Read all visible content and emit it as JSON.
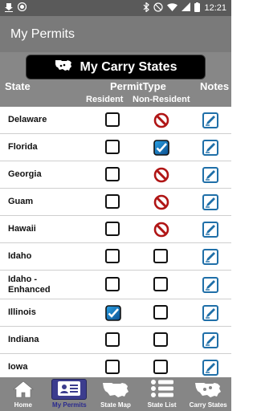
{
  "status_bar": {
    "time": "12:21"
  },
  "app_bar": {
    "title": "My Permits"
  },
  "carry_button": {
    "label": "My Carry States"
  },
  "columns": {
    "state": "State",
    "permit_type": "PermitType",
    "notes": "Notes",
    "resident": "Resident",
    "non_resident": "Non-Resident"
  },
  "rows": [
    {
      "name": "Delaware",
      "resident": "empty",
      "non_resident": "prohibited"
    },
    {
      "name": "Florida",
      "resident": "empty",
      "non_resident": "checked"
    },
    {
      "name": "Georgia",
      "resident": "empty",
      "non_resident": "prohibited"
    },
    {
      "name": "Guam",
      "resident": "empty",
      "non_resident": "prohibited"
    },
    {
      "name": "Hawaii",
      "resident": "empty",
      "non_resident": "prohibited"
    },
    {
      "name": "Idaho",
      "resident": "empty",
      "non_resident": "empty"
    },
    {
      "name": "Idaho - Enhanced",
      "resident": "empty",
      "non_resident": "empty"
    },
    {
      "name": "Illinois",
      "resident": "checked",
      "non_resident": "empty"
    },
    {
      "name": "Indiana",
      "resident": "empty",
      "non_resident": "empty"
    },
    {
      "name": "Iowa",
      "resident": "empty",
      "non_resident": "empty"
    }
  ],
  "bottom_nav": [
    {
      "label": "Home",
      "icon": "home-icon"
    },
    {
      "label": "My Permits",
      "icon": "permit-card-icon",
      "active": true
    },
    {
      "label": "State Map",
      "icon": "usa-map-icon"
    },
    {
      "label": "State List",
      "icon": "list-icon"
    },
    {
      "label": "Carry States",
      "icon": "carry-states-icon"
    }
  ],
  "colors": {
    "app_bar": "#7a7a7a",
    "header": "#878787",
    "prohibited": "#b01515",
    "checked": "#1a6fb5",
    "notes": "#1f6fa8",
    "active_nav": "#3c3d8e"
  }
}
